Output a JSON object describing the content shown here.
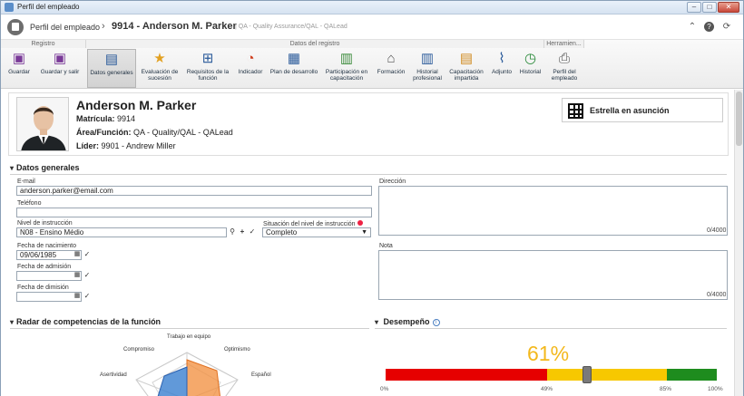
{
  "window": {
    "title": "Perfil del empleado"
  },
  "header": {
    "breadcrumb": "Perfil del empleado",
    "separator": "›",
    "title": "9914 - Anderson M. Parker",
    "subtitle": "|   QA - Quality Assurance/QAL - QALead"
  },
  "ribbon": {
    "groups": [
      "Registro",
      "Datos del registro",
      "Herramien..."
    ],
    "buttons": [
      {
        "label": "Guardar",
        "icon": "save-icon"
      },
      {
        "label": "Guardar y salir",
        "icon": "save-exit-icon"
      },
      {
        "label": "Datos generales",
        "icon": "general-data-icon"
      },
      {
        "label": "Evaluación de sucesión",
        "icon": "star-info-icon"
      },
      {
        "label": "Requisitos de la función",
        "icon": "org-chart-icon"
      },
      {
        "label": "Indicador",
        "icon": "gauge-icon"
      },
      {
        "label": "Plan de desarrollo",
        "icon": "plan-icon"
      },
      {
        "label": "Participación en capacitación",
        "icon": "training-icon"
      },
      {
        "label": "Formación",
        "icon": "institution-icon"
      },
      {
        "label": "Historial profesional",
        "icon": "books-icon"
      },
      {
        "label": "Capacitación impartida",
        "icon": "briefcase-icon"
      },
      {
        "label": "Adjunto",
        "icon": "paperclip-icon"
      },
      {
        "label": "Historial",
        "icon": "history-icon"
      },
      {
        "label": "Perfil del empleado",
        "icon": "printer-icon"
      }
    ]
  },
  "profile": {
    "name": "Anderson M. Parker",
    "matricula_label": "Matrícula:",
    "matricula": "9914",
    "area_label": "Área/Función:",
    "area": "QA - Quality/QAL - QALead",
    "lider_label": "Líder:",
    "lider": "9901 - Andrew Miller",
    "star_button": "Estrella en asunción"
  },
  "general": {
    "section_title": "Datos generales",
    "email_label": "E-mail",
    "email": "anderson.parker@email.com",
    "phone_label": "Teléfono",
    "phone": "",
    "education_label": "Nivel de instrucción",
    "education": "N08 - Ensino Médio",
    "education_status_label": "Situación del nivel de instrucción",
    "education_status": "Completo",
    "birth_label": "Fecha de nacimiento",
    "birth": "09/06/1985",
    "admission_label": "Fecha de admisión",
    "admission": "",
    "dismissal_label": "Fecha de dimisión",
    "dismissal": "",
    "address_label": "Dirección",
    "address_counter": "0/4000",
    "note_label": "Nota",
    "note_counter": "0/4000"
  },
  "radar": {
    "section_title": "Radar de competencias de la función",
    "axes": [
      "Trabajo en equipo",
      "Optimismo",
      "Español",
      "Asertividad",
      "Compromiso"
    ]
  },
  "performance": {
    "section_title": "Desempeño",
    "value_label": "61%",
    "value": 61,
    "ticks": [
      "0%",
      "49%",
      "85%",
      "100%"
    ],
    "colors": {
      "low": "#e60000",
      "mid": "#f7c800",
      "high": "#1e8c1e"
    }
  }
}
